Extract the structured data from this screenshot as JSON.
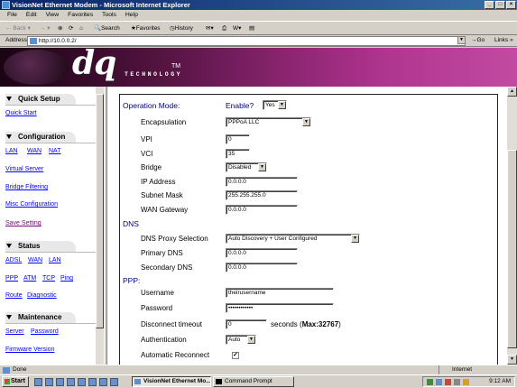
{
  "window": {
    "title": "VisionNet Ethernet Modem - Microsoft Internet Explorer"
  },
  "menu": [
    "File",
    "Edit",
    "View",
    "Favorites",
    "Tools",
    "Help"
  ],
  "toolbar": {
    "back": "Back",
    "search": "Search",
    "favorites": "Favorites",
    "history": "History"
  },
  "address": {
    "label": "Address",
    "url": "http://10.0.0.2/",
    "go": "Go",
    "links": "Links"
  },
  "banner": {
    "logo": "dq",
    "tech": "TECHNOLOGY",
    "tm": "TM"
  },
  "nav": {
    "quick_setup": {
      "title": "Quick Setup",
      "items": [
        "Quick Start"
      ]
    },
    "configuration": {
      "title": "Configuration",
      "items": [
        "LAN",
        "WAN",
        "NAT",
        "Virtual Server",
        "Bridge Filtering",
        "Misc Configuration",
        "Save Setting"
      ]
    },
    "status": {
      "title": "Status",
      "items": [
        "ADSL",
        "WAN",
        "LAN",
        "PPP",
        "ATM",
        "TCP",
        "Ping",
        "Route",
        "Diagnostic"
      ]
    },
    "maintenance": {
      "title": "Maintenance",
      "items": [
        "Server",
        "Password",
        "Firmware Version"
      ]
    }
  },
  "form": {
    "operation_mode": {
      "label": "Operation Mode:",
      "enable_label": "Enable?",
      "enable_value": "Yes"
    },
    "encapsulation": {
      "label": "Encapsulation",
      "value": "PPPoA LLC"
    },
    "vpi": {
      "label": "VPI",
      "value": "0"
    },
    "vci": {
      "label": "VCI",
      "value": "35"
    },
    "bridge": {
      "label": "Bridge",
      "value": "Disabled"
    },
    "ip_address": {
      "label": "IP Address",
      "value": "0.0.0.0"
    },
    "subnet_mask": {
      "label": "Subnet Mask",
      "value": "255.255.255.0"
    },
    "wan_gateway": {
      "label": "WAN Gateway",
      "value": "0.0.0.0"
    },
    "dns_section": "DNS",
    "dns_proxy": {
      "label": "DNS Proxy Selection",
      "value": "Auto Discovery + User Configured"
    },
    "primary_dns": {
      "label": "Primary DNS",
      "value": "0.0.0.0"
    },
    "secondary_dns": {
      "label": "Secondary DNS",
      "value": "0.0.0.0"
    },
    "ppp_section": "PPP:",
    "username": {
      "label": "Username",
      "value": "theirusername"
    },
    "password": {
      "label": "Password",
      "value": "••••••••••••"
    },
    "disconnect": {
      "label": "Disconnect timeout",
      "value": "0",
      "suffix": "seconds (",
      "max": "Max:32767",
      ")": ")"
    },
    "authentication": {
      "label": "Authentication",
      "value": "Auto"
    },
    "auto_reconnect": {
      "label": "Automatic Reconnect",
      "checked": "✓"
    }
  },
  "statusbar": {
    "text": "Done",
    "zone": "Internet"
  },
  "taskbar": {
    "start": "Start",
    "tasks": [
      "VisionNet Ethernet Mo...",
      "Command Prompt"
    ],
    "clock": "9:12 AM"
  }
}
